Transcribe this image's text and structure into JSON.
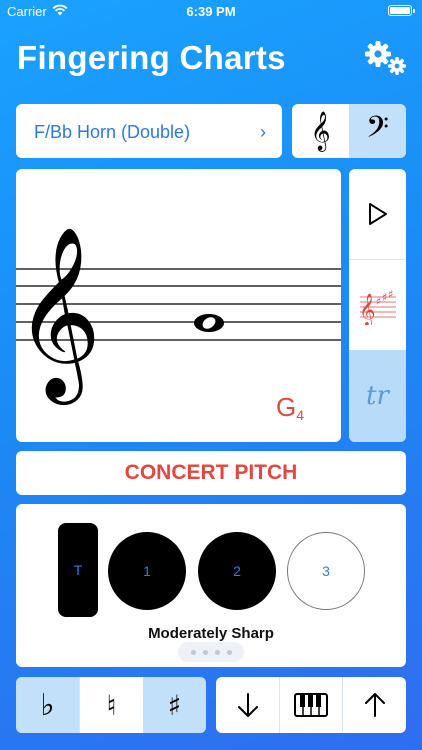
{
  "status_bar": {
    "carrier": "Carrier",
    "time": "6:39 PM"
  },
  "header": {
    "title": "Fingering Charts",
    "settings_icon": "gear-icon"
  },
  "instrument": {
    "name": "F/Bb Horn (Double)",
    "chevron": "›"
  },
  "clef_selector": {
    "treble": "𝄞",
    "bass": "𝄢",
    "selected": "bass"
  },
  "note": {
    "letter": "G",
    "octave": "4"
  },
  "side_controls": {
    "play_icon": "play-icon",
    "key_signature_icon": "key-signature-icon",
    "trill_label": "tr",
    "selected": "trill"
  },
  "concert_pitch": {
    "label": "CONCERT PITCH"
  },
  "fingering": {
    "valves": [
      {
        "label": "T",
        "pressed": true
      },
      {
        "label": "1",
        "pressed": true
      },
      {
        "label": "2",
        "pressed": true
      },
      {
        "label": "3",
        "pressed": false
      }
    ],
    "tuning": "Moderately Sharp",
    "page_count": 4,
    "current_page": 1
  },
  "accidentals": {
    "flat": "♭",
    "natural": "♮",
    "sharp": "♯",
    "selected": [
      "flat",
      "sharp"
    ]
  },
  "tools": {
    "down_icon": "arrow-down-icon",
    "keyboard_icon": "piano-keyboard-icon",
    "up_icon": "arrow-up-icon"
  },
  "colors": {
    "accent_blue": "#2b79e3",
    "note_red": "#e2483f",
    "selected_bg": "#c3e0fb"
  }
}
